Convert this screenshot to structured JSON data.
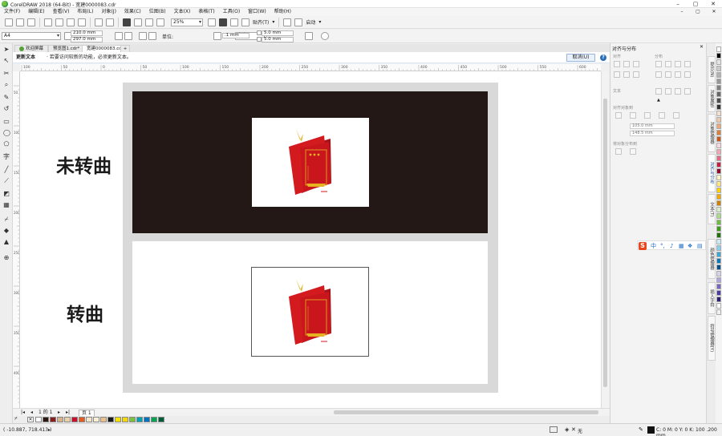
{
  "window": {
    "title": "CorelDRAW 2018 (64-Bit) - 宽建0000083.cdr",
    "controls": [
      "–",
      "▢",
      "✕"
    ]
  },
  "menu": {
    "items": [
      "文件(F)",
      "编辑(E)",
      "查看(V)",
      "布局(L)",
      "对象(J)",
      "效果(C)",
      "位图(B)",
      "文本(X)",
      "表格(T)",
      "工具(O)",
      "窗口(W)",
      "帮助(H)"
    ]
  },
  "standard_toolbar": {
    "zoom": "25%",
    "snap_label": "贴齐(T)",
    "launch_label": "启动"
  },
  "property_bar": {
    "page_size": "A4",
    "width": "210.0 mm",
    "height": "297.0 mm",
    "units_label": "单位:",
    "units_value": "毫米",
    "nudge": ".1 mm",
    "dup_x": "5.0 mm",
    "dup_y": "5.0 mm"
  },
  "tabs": [
    {
      "label": "欢迎屏幕",
      "active": false
    },
    {
      "label": "预览图1.cdr*",
      "active": false
    },
    {
      "label": "宽建0000083.cdr",
      "active": true
    }
  ],
  "hint_bar": {
    "badge": "更新文本",
    "message": "·  若要访问较新的功能，必须更新文本。",
    "cancel_label": "取消(U)",
    "help_glyph": "?",
    "close_glyph": "✕"
  },
  "ruler": {
    "top_ticks": [
      "100",
      "50",
      "0",
      "50",
      "100",
      "150",
      "200",
      "250",
      "300",
      "350",
      "400",
      "450",
      "500",
      "550",
      "600",
      "650",
      "700"
    ],
    "left_ticks": [
      "50",
      "100",
      "150",
      "200",
      "250",
      "300",
      "350",
      "400"
    ]
  },
  "canvas": {
    "label_top": "未转曲",
    "label_bottom": "转曲",
    "colors": {
      "dark_panel": "#231815",
      "frame": "#d9d9d9",
      "book_red": "#d31a1f",
      "book_dark_red": "#a5141a",
      "gold": "#e6b422"
    }
  },
  "page_nav": {
    "counter": "1 的 1",
    "page_tab": "页 1"
  },
  "palette": {
    "colors": [
      "#ffffff",
      "#2b1a14",
      "#8b1c1c",
      "#d5b48a",
      "#e8d3a7",
      "#c8102e",
      "#e55b20",
      "#f3e6c9",
      "#f9f0d4",
      "#e9c089",
      "#1a1a1a",
      "#f5e200",
      "#f6d800",
      "#7bc143",
      "#00a3b4",
      "#0071bc",
      "#00a651",
      "#005c38"
    ]
  },
  "status": {
    "coords": "( -10.887, 718.413 )",
    "fill_info": "C: 0 M: 0 Y: 0 K: 100  .200 mm",
    "fill_none": "无"
  },
  "docker": {
    "title": "对齐与分布",
    "align_label": "对齐",
    "distribute_label": "分布",
    "text_label": "文本",
    "alignto_label": "对齐对象到",
    "field1": "105.0 mm",
    "field2": "148.5 mm",
    "distribute_to_label": "将对象分布到"
  },
  "side_tabs": [
    "提示(N)",
    "对象属性",
    "对象管理器",
    "对齐与分布",
    "文本(T)",
    "颜色管理器",
    "插入字符",
    "符号管理器(Y)"
  ],
  "vertical_palette": [
    "#ffffff",
    "#000000",
    "#e5e5e5",
    "#cccccc",
    "#b3b3b3",
    "#999999",
    "#808080",
    "#666666",
    "#4d4d4d",
    "#333333",
    "#f5e0d0",
    "#f2c9a8",
    "#e9a97a",
    "#dd7f45",
    "#c85a1f",
    "#f9d7de",
    "#f1a7b6",
    "#e36b86",
    "#c21f43",
    "#8e0e28",
    "#fff4c2",
    "#ffe680",
    "#ffd200",
    "#f5a800",
    "#d17f00",
    "#d8f0c9",
    "#a8de8a",
    "#6cbf3f",
    "#3d9a1b",
    "#1f6f0c",
    "#c8ebf5",
    "#89cfe9",
    "#3fa7d6",
    "#1279b8",
    "#0b4f86",
    "#d9d2ef",
    "#b3a4dd",
    "#7d66c1",
    "#513a9e",
    "#2f1f6e",
    "#ffffff",
    "#f0f0f0"
  ]
}
